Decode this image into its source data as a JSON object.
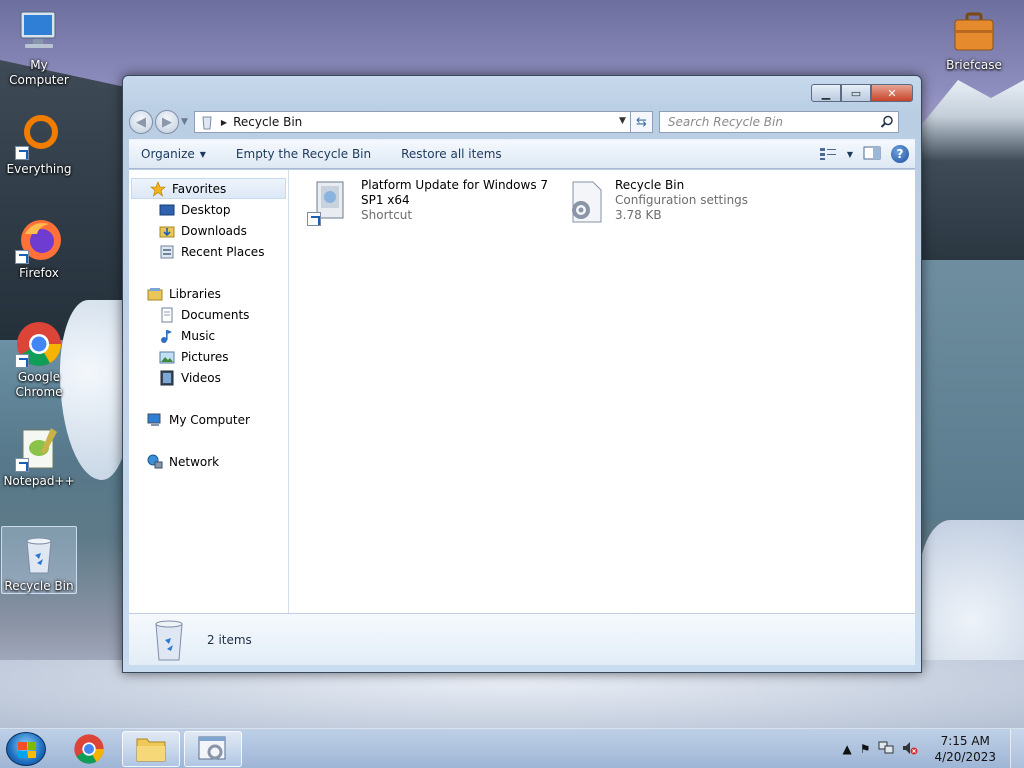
{
  "desktop": {
    "icons": [
      {
        "label": "My Computer"
      },
      {
        "label": "Everything"
      },
      {
        "label": "Firefox"
      },
      {
        "label": "Google Chrome"
      },
      {
        "label": "Notepad++"
      },
      {
        "label": "Recycle Bin"
      },
      {
        "label": "Briefcase"
      }
    ]
  },
  "window": {
    "address": {
      "location": "Recycle Bin"
    },
    "search": {
      "placeholder": "Search Recycle Bin"
    },
    "toolbar": {
      "organize": "Organize",
      "empty": "Empty the Recycle Bin",
      "restore": "Restore all items"
    },
    "nav": {
      "favorites": "Favorites",
      "desktop": "Desktop",
      "downloads": "Downloads",
      "recent": "Recent Places",
      "libraries": "Libraries",
      "documents": "Documents",
      "music": "Music",
      "pictures": "Pictures",
      "videos": "Videos",
      "computer": "My Computer",
      "network": "Network"
    },
    "files": [
      {
        "name_line1": "Platform Update for Windows 7",
        "name_line2": "SP1 x64",
        "type": "Shortcut"
      },
      {
        "name_line1": "Recycle Bin",
        "type": "Configuration settings",
        "size": "3.78 KB"
      }
    ],
    "status": {
      "count": "2 items"
    }
  },
  "taskbar": {
    "time": "7:15 AM",
    "date": "4/20/2023"
  },
  "colors": {
    "accent": "#1e395b",
    "close": "#c7442a"
  }
}
